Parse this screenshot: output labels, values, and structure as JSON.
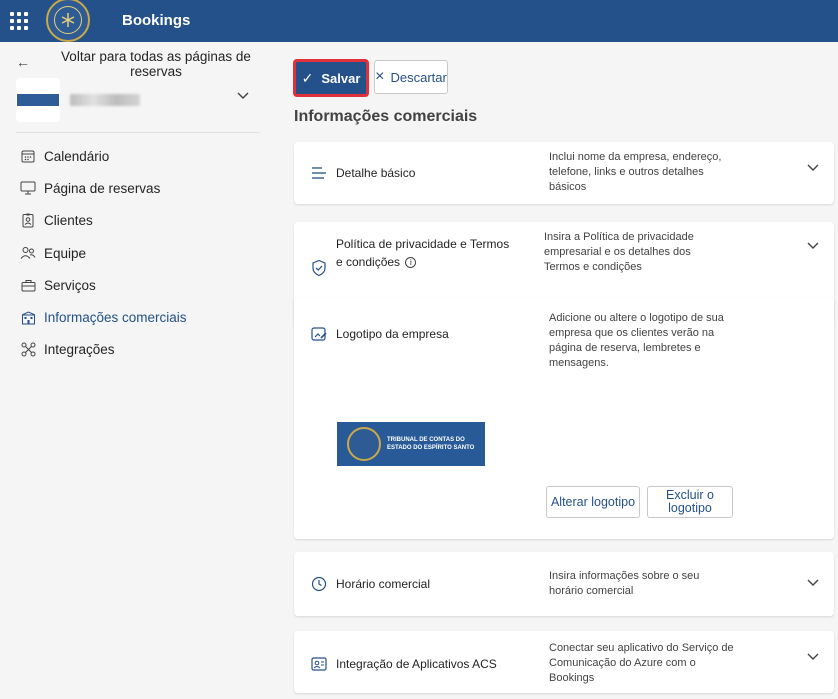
{
  "app": {
    "title": "Bookings"
  },
  "sidebar": {
    "back_label": "Voltar para todas as páginas de reservas",
    "items": [
      {
        "label": "Calendário",
        "icon": "calendar-icon"
      },
      {
        "label": "Página de reservas",
        "icon": "monitor-icon"
      },
      {
        "label": "Clientes",
        "icon": "contact-card-icon"
      },
      {
        "label": "Equipe",
        "icon": "people-icon"
      },
      {
        "label": "Serviços",
        "icon": "briefcase-icon"
      },
      {
        "label": "Informações comerciais",
        "icon": "building-icon",
        "active": true
      },
      {
        "label": "Integrações",
        "icon": "integration-icon"
      }
    ]
  },
  "toolbar": {
    "save_label": "Salvar",
    "discard_label": "Descartar"
  },
  "main": {
    "section_title": "Informações comerciais",
    "cards": {
      "basic": {
        "title": "Detalhe básico",
        "desc": "Inclui nome da empresa, endereço, telefone, links e outros detalhes básicos"
      },
      "privacy": {
        "title": "Política de privacidade e Termos e condições",
        "desc": "Insira a Política de privacidade empresarial e os detalhes dos Termos e condições"
      },
      "logo": {
        "title": "Logotipo da empresa",
        "desc": "Adicione ou altere o logotipo de sua empresa que os clientes verão na página de reserva, lembretes e mensagens.",
        "change_label": "Alterar logotipo",
        "delete_label": "Excluir o logotipo",
        "logo_text_line1": "TRIBUNAL DE CONTAS DO",
        "logo_text_line2": "ESTADO DO ESPÍRITO SANTO"
      },
      "hours": {
        "title": "Horário comercial",
        "desc": "Insira informações sobre o seu horário comercial"
      },
      "acs": {
        "title": "Integração de Aplicativos ACS",
        "desc": "Conectar seu aplicativo do Serviço de Comunicação do Azure com o Bookings"
      }
    }
  },
  "colors": {
    "brand": "#245189",
    "highlight": "#e0303a"
  }
}
